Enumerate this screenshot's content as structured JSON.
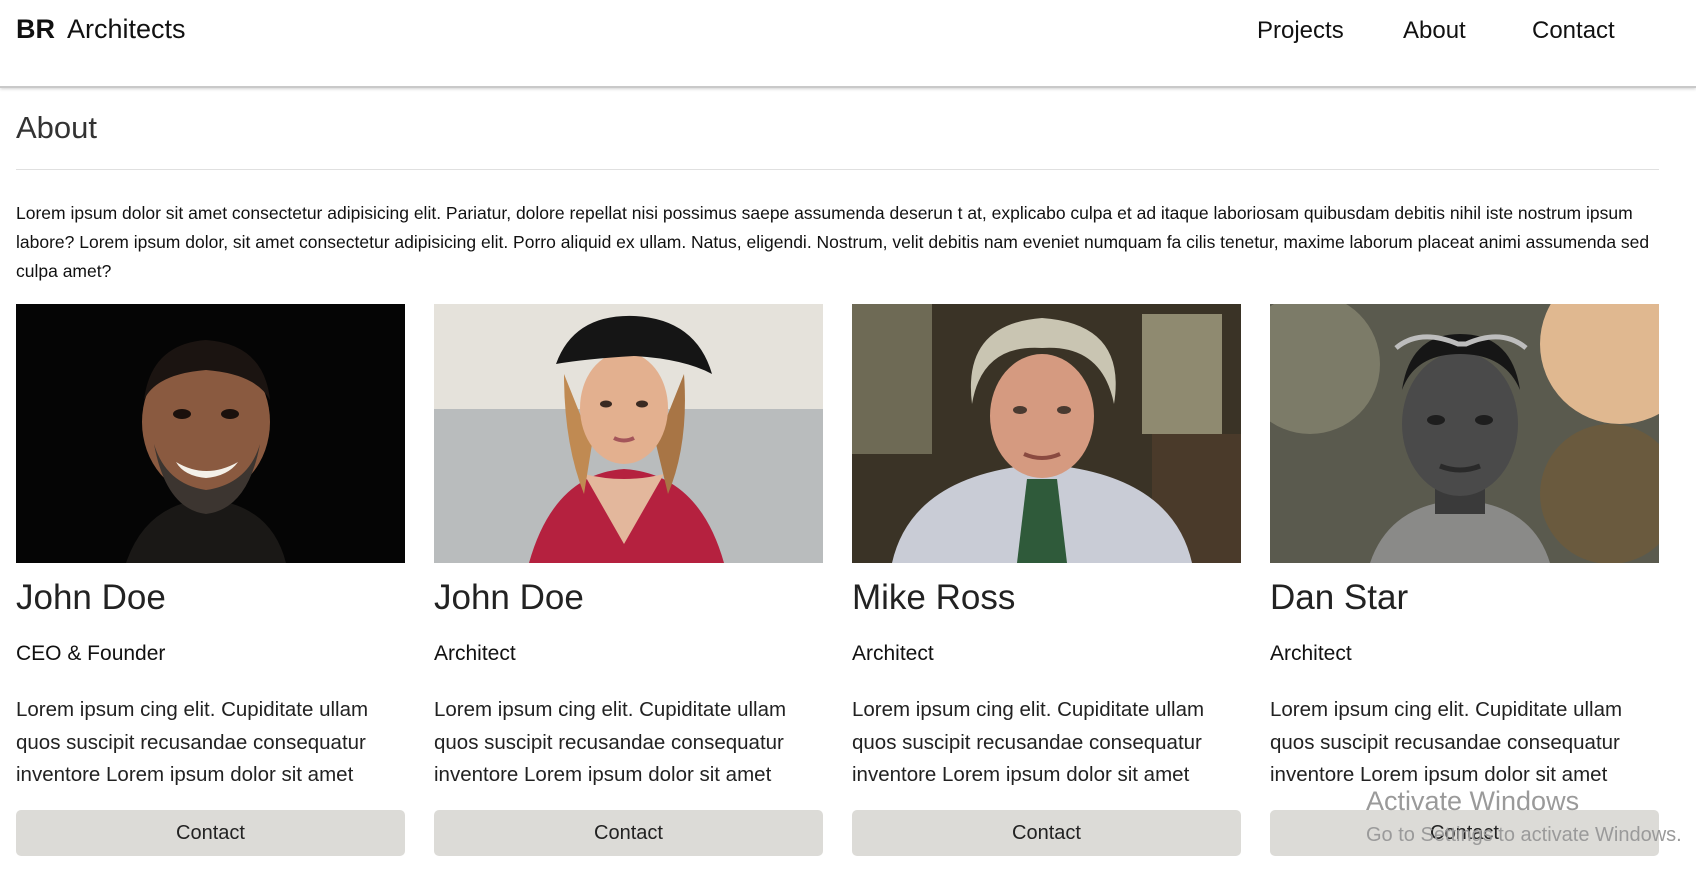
{
  "header": {
    "brand_bold": "BR",
    "brand_rest": "Architects",
    "nav": [
      "Projects",
      "About",
      "Contact"
    ]
  },
  "about": {
    "title": "About",
    "intro": "Lorem ipsum dolor sit amet consectetur adipisicing elit. Pariatur, dolore repellat nisi possimus saepe assumenda deserun t at, explicabo culpa et ad itaque laboriosam quibusdam debitis nihil iste nostrum ipsum labore? Lorem ipsum dolor, sit amet consectetur adipisicing elit. Porro aliquid ex ullam. Natus, eligendi. Nostrum, velit debitis nam eveniet numquam fa cilis tenetur, maxime laborum placeat animi assumenda sed culpa amet?"
  },
  "team": [
    {
      "name": "John Doe",
      "role": "CEO & Founder",
      "description": "Lorem ipsum cing elit. Cupiditate ullam quos suscipit recusandae consequatur inventore Lorem ipsum dolor sit amet",
      "button": "Contact",
      "photo": "portrait-smiling-bearded-man"
    },
    {
      "name": "John Doe",
      "role": "Architect",
      "description": "Lorem ipsum cing elit. Cupiditate ullam quos suscipit recusandae consequatur inventore Lorem ipsum dolor sit amet",
      "button": "Contact",
      "photo": "portrait-woman-black-hat"
    },
    {
      "name": "Mike Ross",
      "role": "Architect",
      "description": "Lorem ipsum cing elit. Cupiditate ullam quos suscipit recusandae consequatur inventore Lorem ipsum dolor sit amet",
      "button": "Contact",
      "photo": "portrait-older-man-grey-hair"
    },
    {
      "name": "Dan Star",
      "role": "Architect",
      "description": "Lorem ipsum cing elit. Cupiditate ullam quos suscipit recusandae consequatur inventore Lorem ipsum dolor sit amet",
      "button": "Contact",
      "photo": "portrait-young-man-sunglasses"
    }
  ],
  "watermark": {
    "title": "Activate Windows",
    "subtitle": "Go to Settings to activate Windows."
  }
}
